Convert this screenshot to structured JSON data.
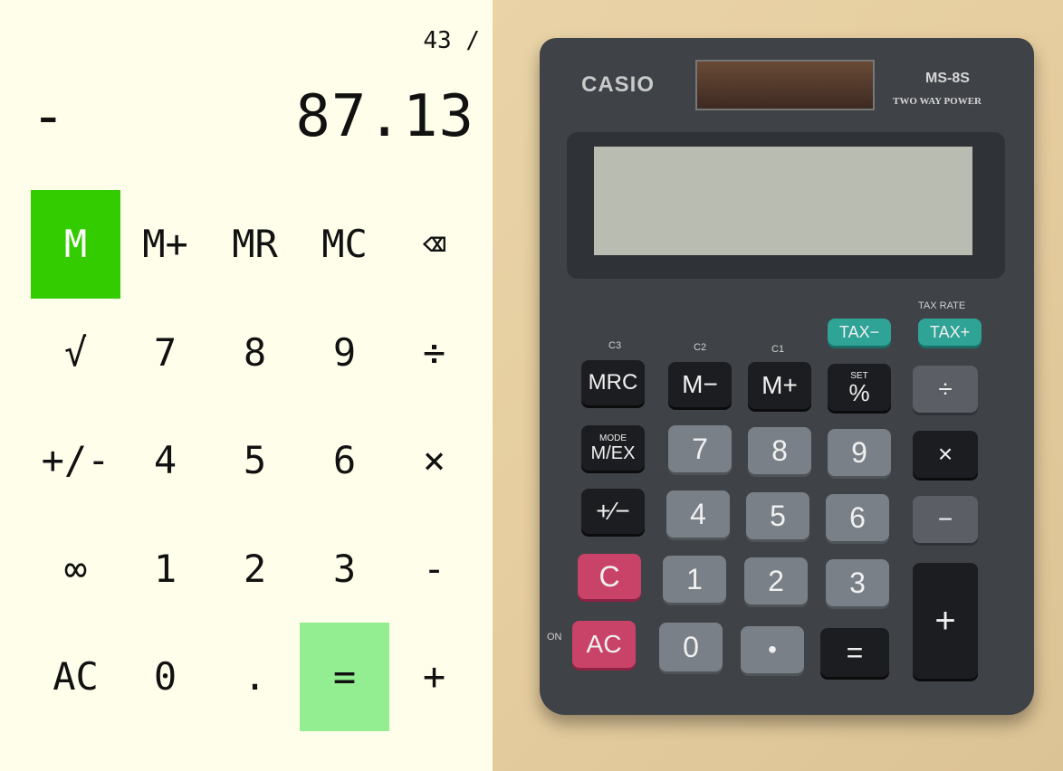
{
  "calculator": {
    "expression": "43 /",
    "operator": "-",
    "display_value": "87.13",
    "keys": [
      {
        "label": "M",
        "name": "memory-key",
        "style": "active-memory"
      },
      {
        "label": "M+",
        "name": "memory-add-key",
        "style": ""
      },
      {
        "label": "MR",
        "name": "memory-recall-key",
        "style": ""
      },
      {
        "label": "MC",
        "name": "memory-clear-key",
        "style": ""
      },
      {
        "label": "⌫",
        "name": "backspace-key",
        "style": ""
      },
      {
        "label": "√",
        "name": "square-root-key",
        "style": ""
      },
      {
        "label": "7",
        "name": "digit-7-key",
        "style": ""
      },
      {
        "label": "8",
        "name": "digit-8-key",
        "style": ""
      },
      {
        "label": "9",
        "name": "digit-9-key",
        "style": ""
      },
      {
        "label": "÷",
        "name": "divide-key",
        "style": ""
      },
      {
        "label": "+/-",
        "name": "negate-key",
        "style": ""
      },
      {
        "label": "4",
        "name": "digit-4-key",
        "style": ""
      },
      {
        "label": "5",
        "name": "digit-5-key",
        "style": ""
      },
      {
        "label": "6",
        "name": "digit-6-key",
        "style": ""
      },
      {
        "label": "×",
        "name": "multiply-key",
        "style": ""
      },
      {
        "label": "∞",
        "name": "infinity-key",
        "style": ""
      },
      {
        "label": "1",
        "name": "digit-1-key",
        "style": ""
      },
      {
        "label": "2",
        "name": "digit-2-key",
        "style": ""
      },
      {
        "label": "3",
        "name": "digit-3-key",
        "style": ""
      },
      {
        "label": "-",
        "name": "subtract-key",
        "style": ""
      },
      {
        "label": "AC",
        "name": "all-clear-key",
        "style": ""
      },
      {
        "label": "0",
        "name": "digit-0-key",
        "style": ""
      },
      {
        "label": ".",
        "name": "decimal-key",
        "style": ""
      },
      {
        "label": "=",
        "name": "equals-key",
        "style": "equals"
      },
      {
        "label": "+",
        "name": "add-key",
        "style": ""
      }
    ],
    "colors": {
      "background": "#fffeeb",
      "memory_active": "#33cc00",
      "equals": "#92ee90"
    }
  },
  "photo": {
    "brand": "CASIO",
    "model": "MS-8S",
    "model_sub": "TWO WAY POWER",
    "tax_rate_label": "TAX RATE",
    "labels": {
      "c3": "C3",
      "c2": "C2",
      "c1": "C1",
      "on": "ON"
    },
    "keys": {
      "tax_minus": "TAX−",
      "tax_plus": "TAX+",
      "mrc": "MRC",
      "m_minus": "M−",
      "m_plus": "M+",
      "percent": "%",
      "percent_set": "SET",
      "divide": "÷",
      "mode": "MODE",
      "mex": "M/EX",
      "d7": "7",
      "d8": "8",
      "d9": "9",
      "multiply": "×",
      "plusminus": "+⁄−",
      "d4": "4",
      "d5": "5",
      "d6": "6",
      "minus": "−",
      "c": "C",
      "d1": "1",
      "d2": "2",
      "d3": "3",
      "plus": "+",
      "ac": "AC",
      "d0": "0",
      "dot": "•",
      "equals": "="
    }
  }
}
